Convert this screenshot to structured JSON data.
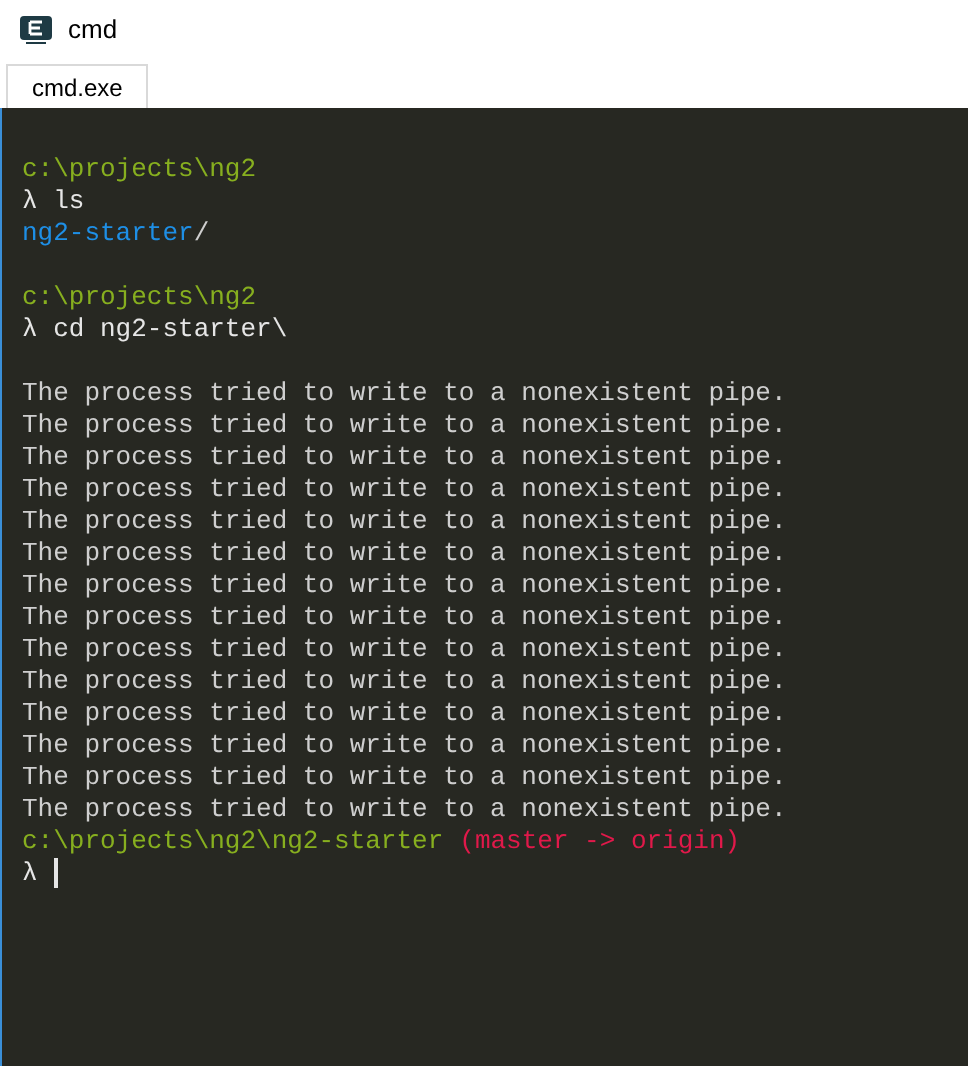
{
  "window": {
    "title": "cmd"
  },
  "tabs": [
    {
      "label": "cmd.exe",
      "selected": true
    }
  ],
  "terminal": {
    "blocks": [
      {
        "lines": [
          {
            "segments": [
              {
                "kind": "path",
                "text": "c:\\projects\\ng2"
              }
            ]
          },
          {
            "segments": [
              {
                "kind": "prompt",
                "text": "λ ls"
              }
            ]
          },
          {
            "segments": [
              {
                "kind": "dir",
                "text": "ng2-starter"
              },
              {
                "kind": "output",
                "text": "/"
              }
            ]
          }
        ]
      },
      {
        "lines": [
          {
            "segments": [
              {
                "kind": "path",
                "text": "c:\\projects\\ng2"
              }
            ]
          },
          {
            "segments": [
              {
                "kind": "prompt",
                "text": "λ cd ng2-starter\\"
              }
            ]
          }
        ]
      },
      {
        "lines": [
          {
            "segments": [
              {
                "kind": "output",
                "text": "The process tried to write to a nonexistent pipe."
              }
            ]
          },
          {
            "segments": [
              {
                "kind": "output",
                "text": "The process tried to write to a nonexistent pipe."
              }
            ]
          },
          {
            "segments": [
              {
                "kind": "output",
                "text": "The process tried to write to a nonexistent pipe."
              }
            ]
          },
          {
            "segments": [
              {
                "kind": "output",
                "text": "The process tried to write to a nonexistent pipe."
              }
            ]
          },
          {
            "segments": [
              {
                "kind": "output",
                "text": "The process tried to write to a nonexistent pipe."
              }
            ]
          },
          {
            "segments": [
              {
                "kind": "output",
                "text": "The process tried to write to a nonexistent pipe."
              }
            ]
          },
          {
            "segments": [
              {
                "kind": "output",
                "text": "The process tried to write to a nonexistent pipe."
              }
            ]
          },
          {
            "segments": [
              {
                "kind": "output",
                "text": "The process tried to write to a nonexistent pipe."
              }
            ]
          },
          {
            "segments": [
              {
                "kind": "output",
                "text": "The process tried to write to a nonexistent pipe."
              }
            ]
          },
          {
            "segments": [
              {
                "kind": "output",
                "text": "The process tried to write to a nonexistent pipe."
              }
            ]
          },
          {
            "segments": [
              {
                "kind": "output",
                "text": "The process tried to write to a nonexistent pipe."
              }
            ]
          },
          {
            "segments": [
              {
                "kind": "output",
                "text": "The process tried to write to a nonexistent pipe."
              }
            ]
          },
          {
            "segments": [
              {
                "kind": "output",
                "text": "The process tried to write to a nonexistent pipe."
              }
            ]
          },
          {
            "segments": [
              {
                "kind": "output",
                "text": "The process tried to write to a nonexistent pipe."
              }
            ]
          },
          {
            "segments": [
              {
                "kind": "path",
                "text": "c:\\projects\\ng2\\ng2-starter"
              },
              {
                "kind": "branch",
                "text": "(master -> origin)"
              }
            ]
          },
          {
            "segments": [
              {
                "kind": "prompt",
                "text": "λ"
              }
            ],
            "cursor": true
          }
        ]
      }
    ]
  }
}
